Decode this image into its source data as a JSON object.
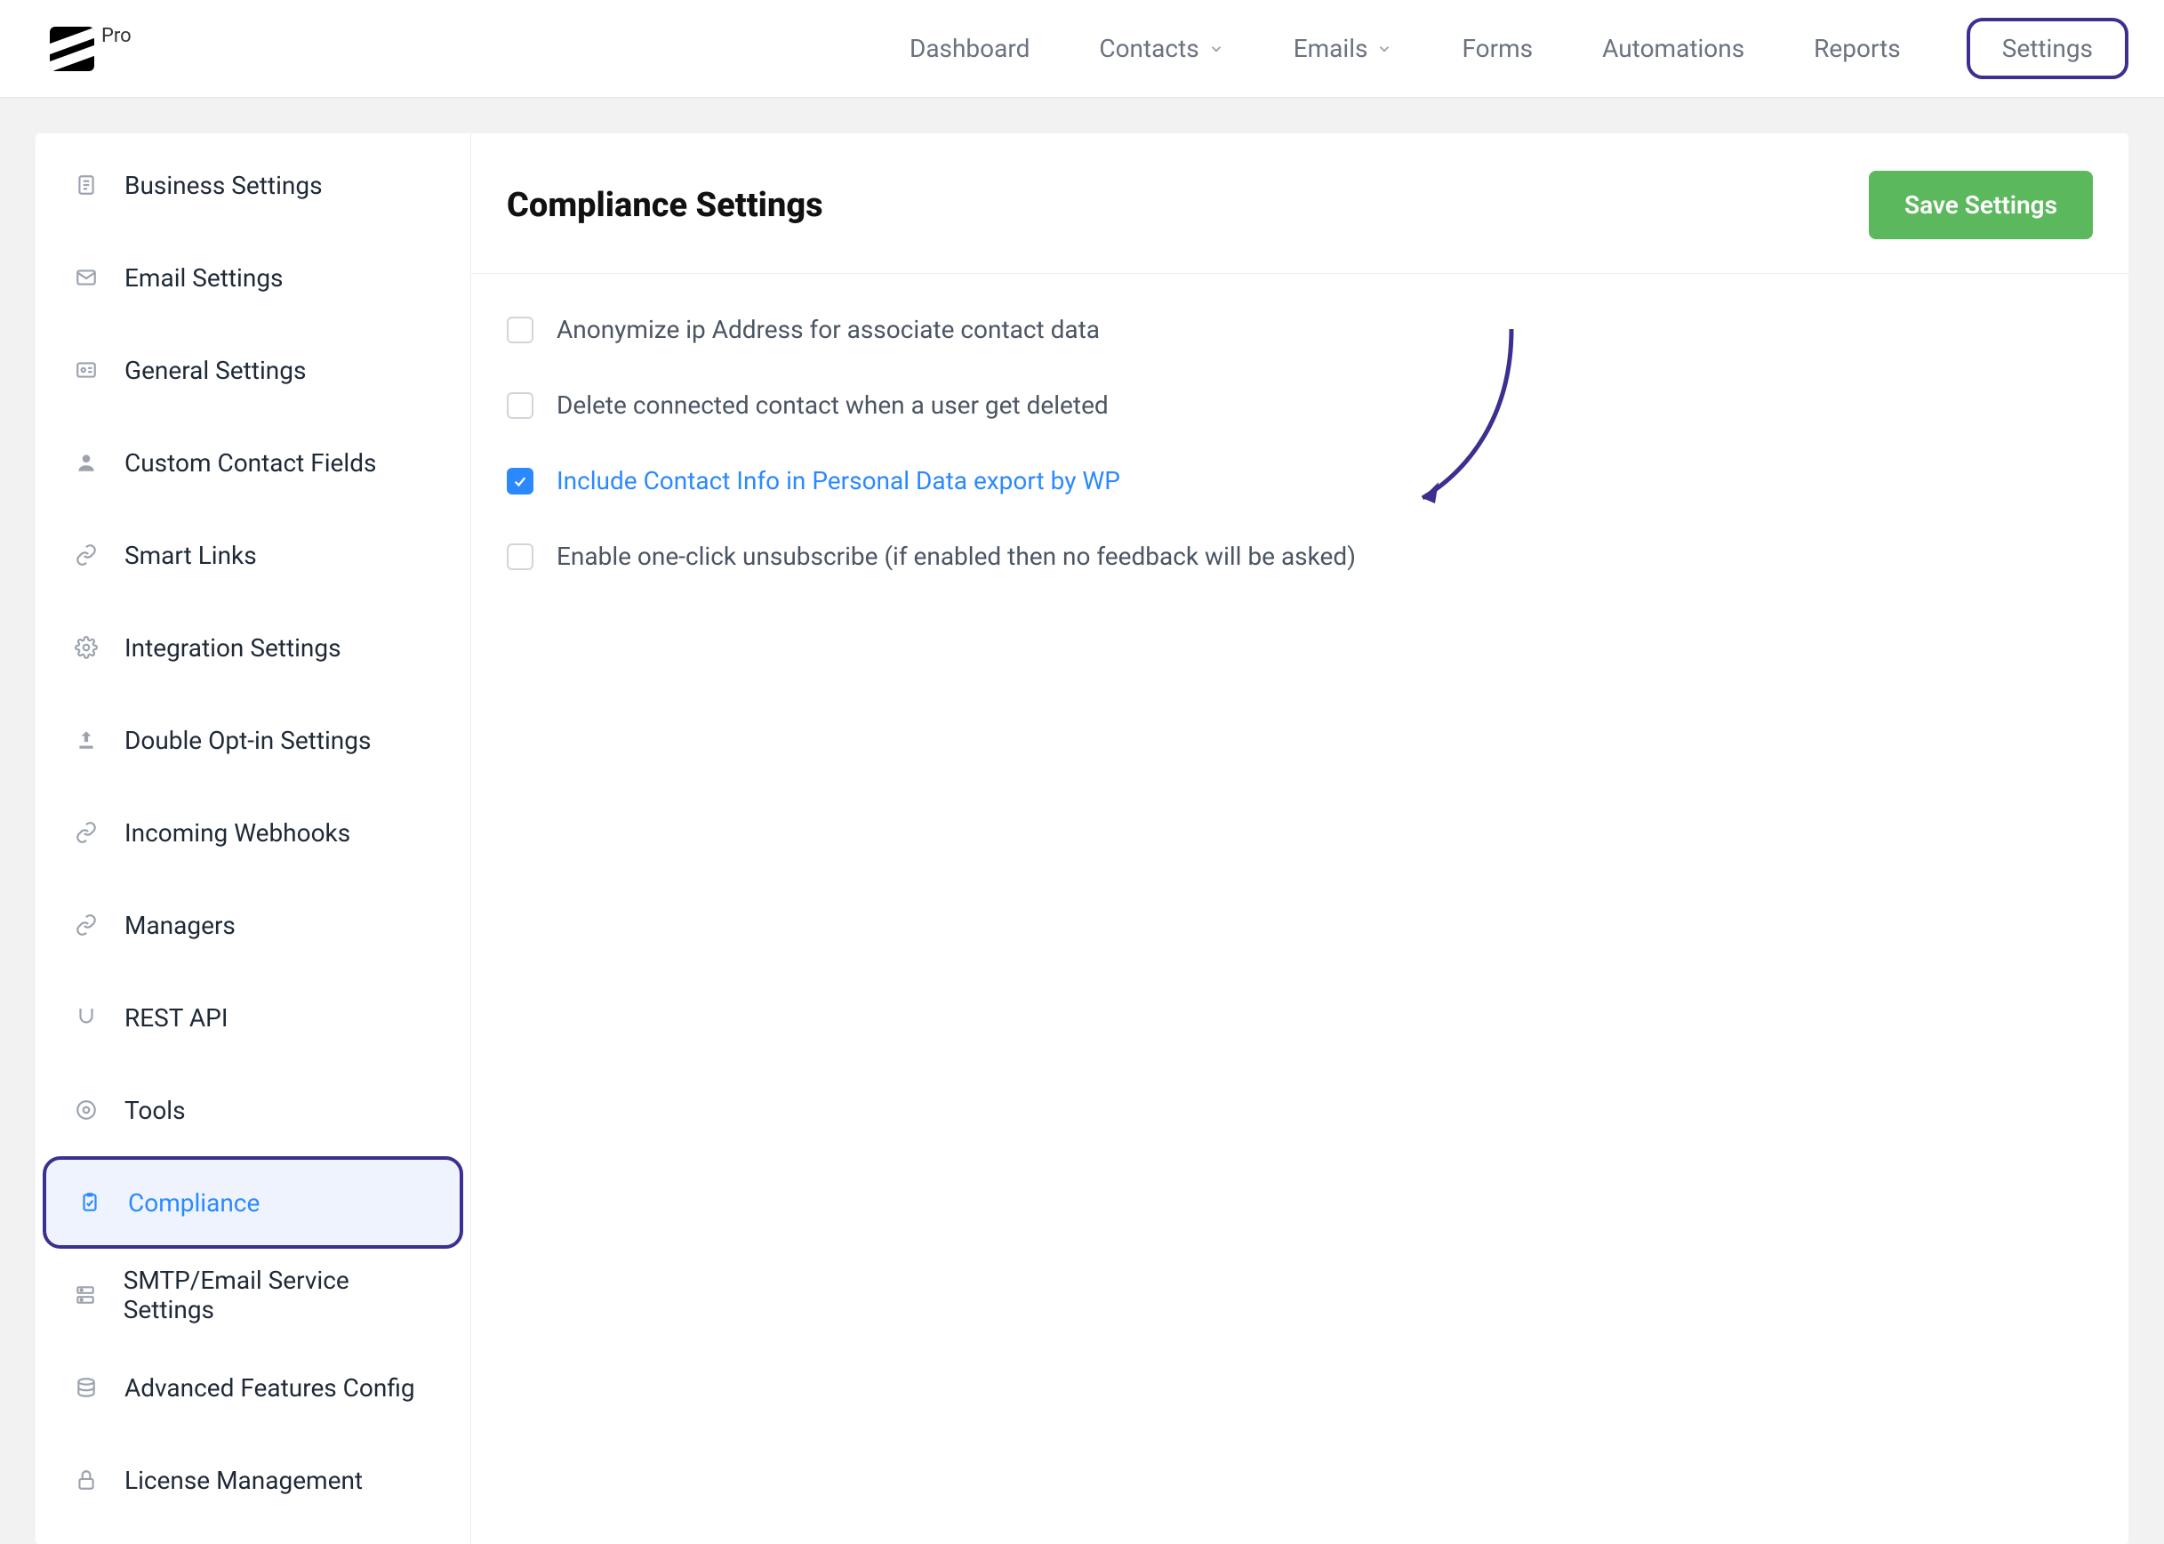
{
  "brand": {
    "pro_label": "Pro"
  },
  "nav": {
    "dashboard": "Dashboard",
    "contacts": "Contacts",
    "emails": "Emails",
    "forms": "Forms",
    "automations": "Automations",
    "reports": "Reports",
    "settings": "Settings"
  },
  "sidebar": {
    "items": [
      {
        "label": "Business Settings",
        "icon": "document"
      },
      {
        "label": "Email Settings",
        "icon": "mail"
      },
      {
        "label": "General Settings",
        "icon": "id-card"
      },
      {
        "label": "Custom Contact Fields",
        "icon": "user"
      },
      {
        "label": "Smart Links",
        "icon": "link"
      },
      {
        "label": "Integration Settings",
        "icon": "gear"
      },
      {
        "label": "Double Opt-in Settings",
        "icon": "upload"
      },
      {
        "label": "Incoming Webhooks",
        "icon": "link"
      },
      {
        "label": "Managers",
        "icon": "link"
      },
      {
        "label": "REST API",
        "icon": "magnet"
      },
      {
        "label": "Tools",
        "icon": "circle"
      },
      {
        "label": "Compliance",
        "icon": "clipboard",
        "active": true
      },
      {
        "label": "SMTP/Email Service Settings",
        "icon": "server"
      },
      {
        "label": "Advanced Features Config",
        "icon": "stack"
      },
      {
        "label": "License Management",
        "icon": "lock"
      }
    ]
  },
  "page": {
    "title": "Compliance Settings",
    "save_button": "Save Settings"
  },
  "options": [
    {
      "label": "Anonymize ip Address for associate contact data",
      "checked": false
    },
    {
      "label": "Delete connected contact when a user get deleted",
      "checked": false
    },
    {
      "label": "Include Contact Info in Personal Data export by WP",
      "checked": true
    },
    {
      "label": "Enable one-click unsubscribe (if enabled then no feedback will be asked)",
      "checked": false
    }
  ],
  "colors": {
    "accent_blue": "#2b89ff",
    "save_green": "#5cb85c",
    "highlight_purple": "#3b2f8f"
  }
}
